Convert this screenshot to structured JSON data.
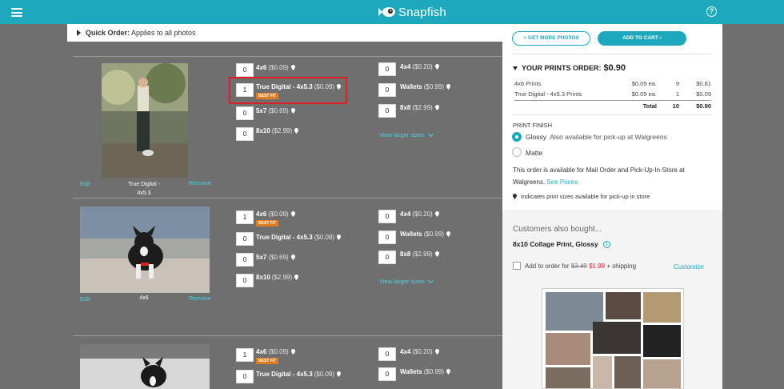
{
  "header": {
    "logo_text": "Snapfish",
    "help": "?"
  },
  "quick_order": {
    "bold": "Quick Order:",
    "text": "Applies to all photos"
  },
  "left_sizes": [
    {
      "name": "4x6",
      "price": "($0.09)"
    },
    {
      "name": "True Digital - 4x5.3",
      "price": "($0.09)"
    },
    {
      "name": "5x7",
      "price": "($0.69)"
    },
    {
      "name": "8x10",
      "price": "($2.99)"
    }
  ],
  "right_sizes": [
    {
      "name": "4x4",
      "price": "($0.20)"
    },
    {
      "name": "Wallets",
      "price": "($0.99)"
    },
    {
      "name": "8x8",
      "price": "($2.99)"
    }
  ],
  "photos": [
    {
      "caption": "True Digital -\n4x5.3",
      "qty_left": [
        "0",
        "1",
        "0",
        "0"
      ],
      "qty_right": [
        "0",
        "0",
        "0"
      ]
    },
    {
      "caption": "4x6",
      "qty_left": [
        "1",
        "0",
        "0",
        "0"
      ],
      "qty_right": [
        "0",
        "0",
        "0"
      ]
    },
    {
      "caption": "",
      "qty_left": [
        "1",
        "0"
      ],
      "qty_right": [
        "0",
        "0"
      ]
    }
  ],
  "labels": {
    "edit": "Edit",
    "remove": "Remove",
    "best_fit": "BEST FIT",
    "view_larger": "View larger sizes"
  },
  "panel": {
    "get_more": "+ GET MORE PHOTOS",
    "add_to_cart": "ADD TO CART",
    "order_title": "YOUR PRINTS ORDER:",
    "order_total": "$0.90",
    "rows": [
      {
        "item": "4x6 Prints",
        "each": "$0.09 ea.",
        "qty": "9",
        "amount": "$0.81"
      },
      {
        "item": "True Digital - 4x5.3 Prints",
        "each": "$0.09 ea.",
        "qty": "1",
        "amount": "$0.09"
      }
    ],
    "total_label": "Total",
    "total_qty": "10",
    "total_amount": "$0.90",
    "finish_title": "PRINT FINISH",
    "glossy": "Glossy",
    "glossy_note": "Also available for pick-up at Walgreens",
    "matte": "Matte",
    "availability": "This order is available for Mail Order and Pick-Up-In-Store at Walgreens.",
    "see_prices": "See Prices",
    "pickup_note": "Indicates print sizes available for pick-up in store",
    "also_title": "Customers also bought...",
    "also_product": "8x10 Collage Print, Glossy",
    "add_text": "Add to order for",
    "old_price": "$3.49",
    "new_price": "$1.99",
    "plus_shipping": "+ shipping",
    "customize": "Customize"
  },
  "colors": {
    "brand": "#1ea8bd",
    "badge": "#e07b21",
    "highlight": "#e01e24",
    "link": "#4fd0e6"
  }
}
